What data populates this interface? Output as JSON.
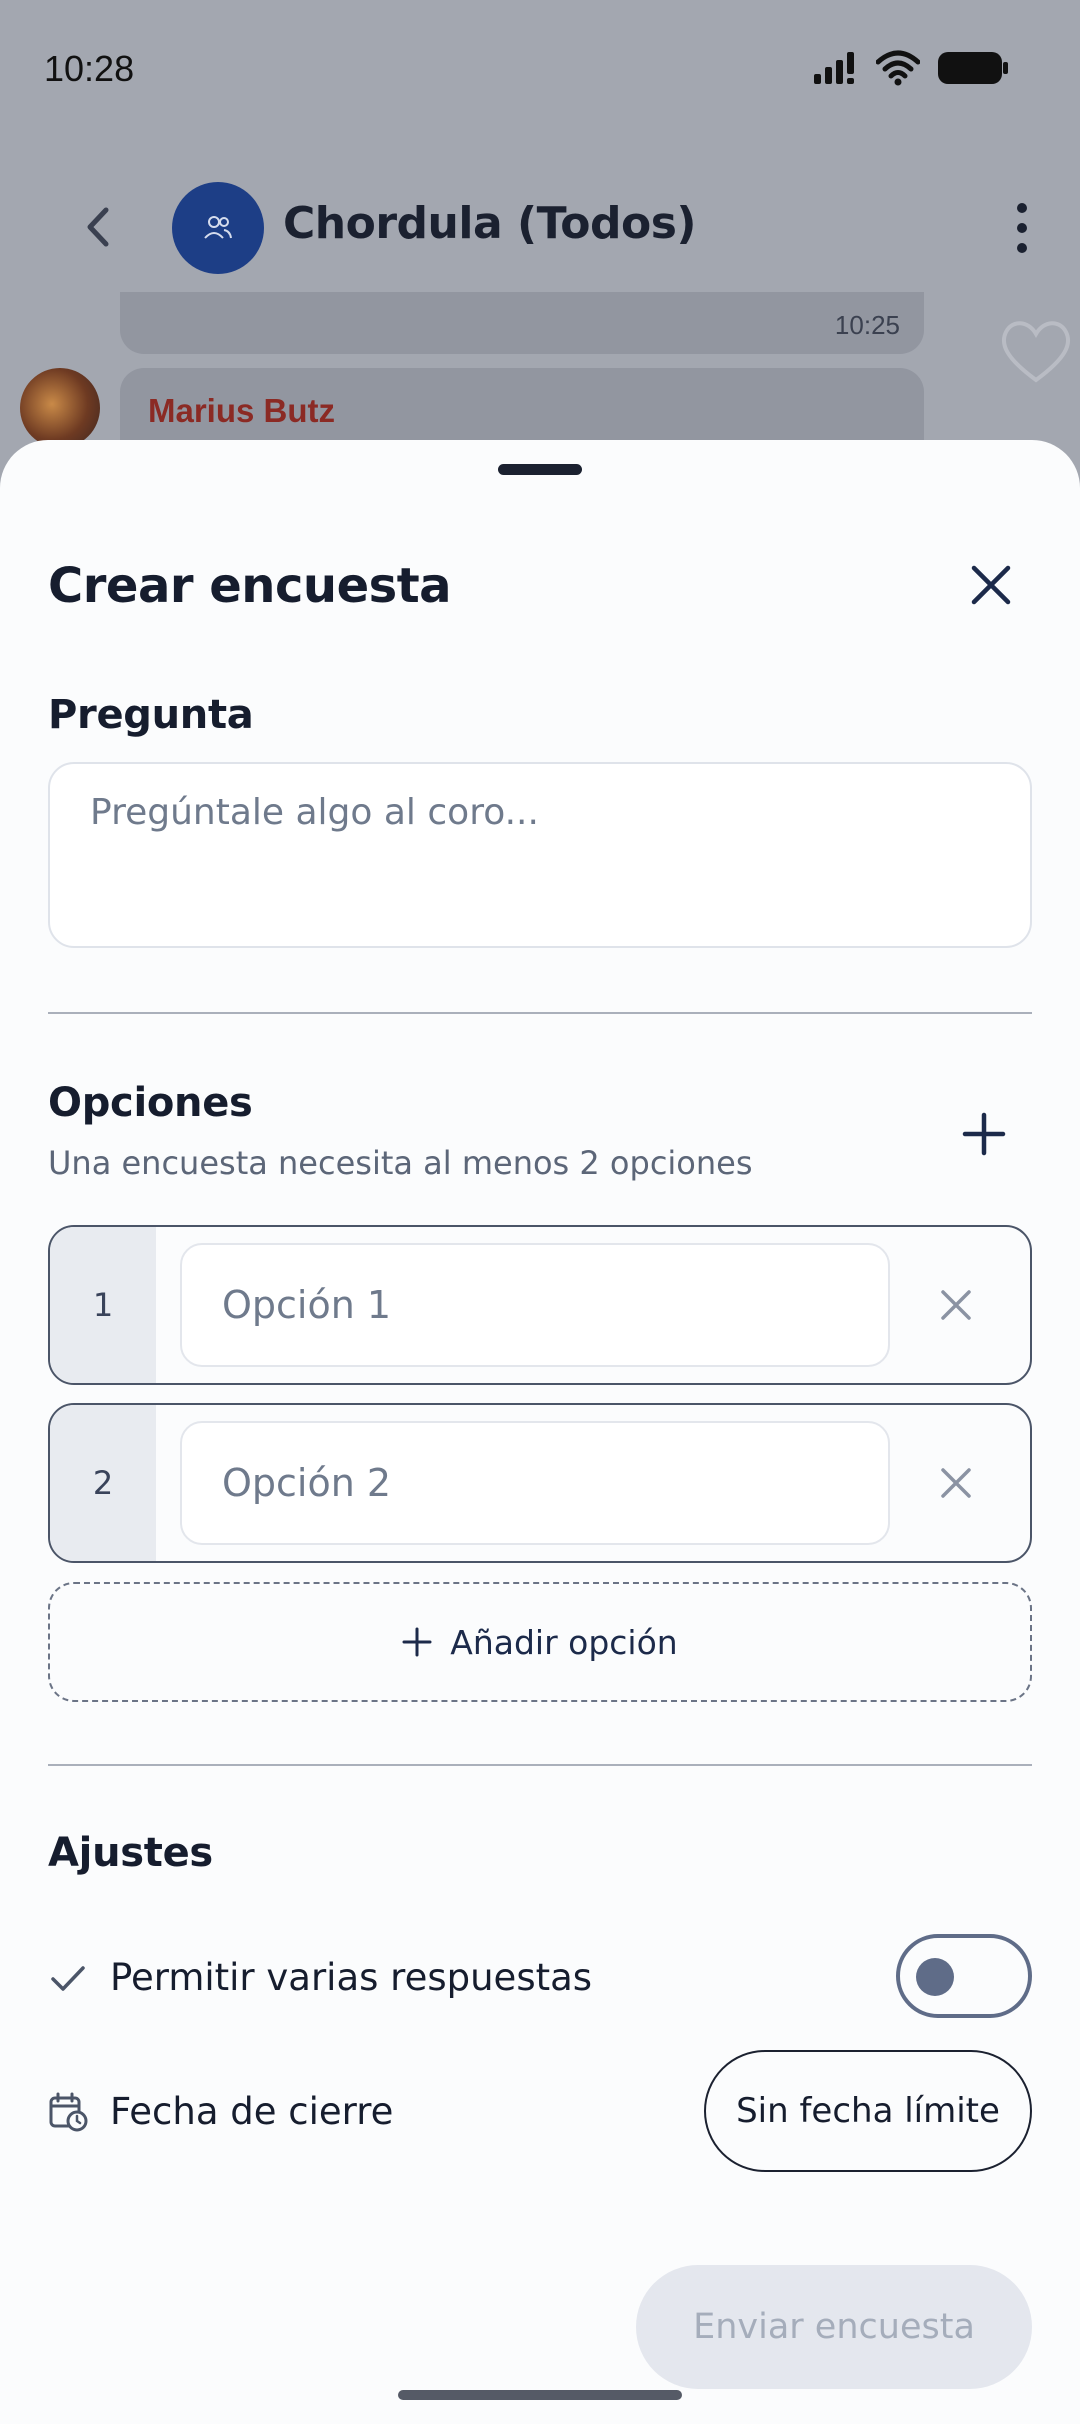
{
  "status_bar": {
    "time": "10:28"
  },
  "chat": {
    "title": "Chordula (Todos)",
    "message_time": "10:25",
    "sender_name": "Marius Butz"
  },
  "sheet": {
    "title": "Crear encuesta",
    "question": {
      "label": "Pregunta",
      "placeholder": "Pregúntale algo al coro..."
    },
    "options": {
      "label": "Opciones",
      "hint": "Una encuesta necesita al menos 2 opciones",
      "items": [
        {
          "number": "1",
          "placeholder": "Opción 1"
        },
        {
          "number": "2",
          "placeholder": "Opción 2"
        }
      ],
      "add_label": "Añadir opción"
    },
    "settings": {
      "label": "Ajustes",
      "multiple_answers": {
        "label": "Permitir varias respuestas",
        "enabled": false
      },
      "closing_date": {
        "label": "Fecha de cierre",
        "value": "Sin fecha límite"
      }
    },
    "send_label": "Enviar encuesta"
  },
  "colors": {
    "accent": "#1d3e86",
    "scrim": "#a3a7b0",
    "sender_name": "#8b2a24",
    "disabled_button": "#e4e7ee"
  }
}
